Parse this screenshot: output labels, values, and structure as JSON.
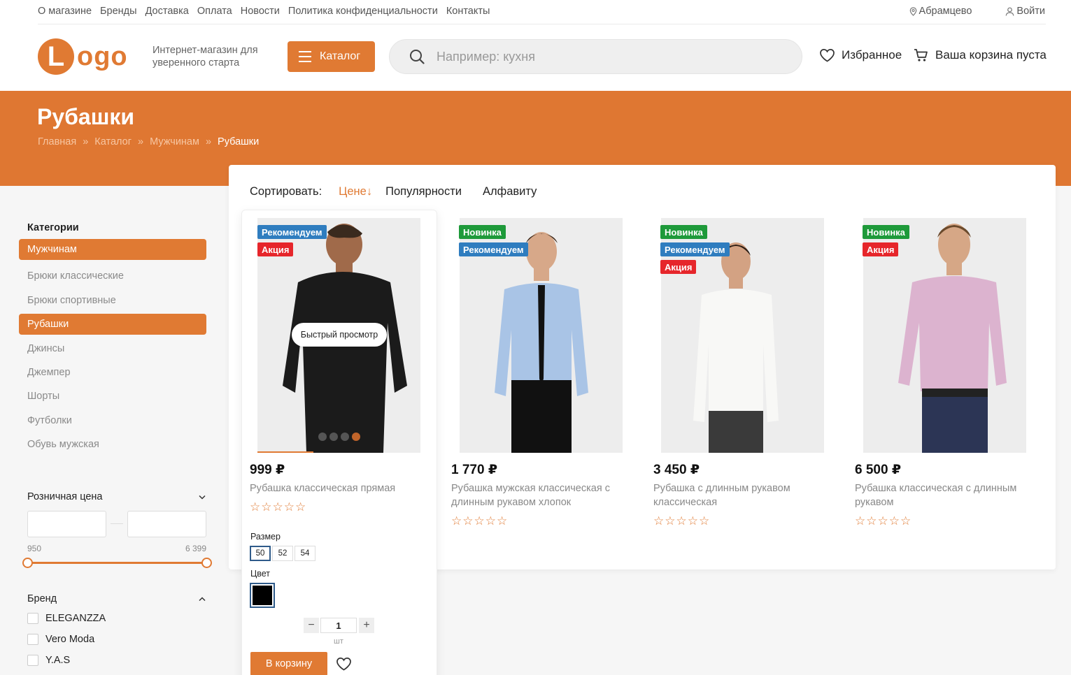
{
  "topnav": [
    "О магазине",
    "Бренды",
    "Доставка",
    "Оплата",
    "Новости",
    "Политика конфиденциальности",
    "Контакты"
  ],
  "location": "Абрамцево",
  "login": "Войти",
  "logo": {
    "letter": "L",
    "rest": "ogo"
  },
  "slogan": "Интернет-магазин для уверенного старта",
  "catalog_label": "Каталог",
  "search_placeholder": "Например: кухня",
  "favorites_label": "Избранное",
  "cart_label": "Ваша корзина пуста",
  "page_title": "Рубашки",
  "breadcrumbs": [
    "Главная",
    "Каталог",
    "Мужчинам",
    "Рубашки"
  ],
  "crumb_sep": "»",
  "sidebar": {
    "title": "Категории",
    "categories": [
      {
        "label": "Мужчинам",
        "active": true
      },
      {
        "label": "Брюки классические",
        "active": false
      },
      {
        "label": "Брюки спортивные",
        "active": false
      },
      {
        "label": "Рубашки",
        "active": true
      },
      {
        "label": "Джинсы",
        "active": false
      },
      {
        "label": "Джемпер",
        "active": false
      },
      {
        "label": "Шорты",
        "active": false
      },
      {
        "label": "Футболки",
        "active": false
      },
      {
        "label": "Обувь мужская",
        "active": false
      }
    ],
    "price_filter": {
      "title": "Розничная цена",
      "min_label": "950",
      "max_label": "6 399"
    },
    "brand_filter": {
      "title": "Бренд",
      "brands": [
        "ELEGANZZA",
        "Vero Moda",
        "Y.A.S"
      ]
    }
  },
  "sort": {
    "label": "Сортировать:",
    "options": [
      "Цене",
      "Популярности",
      "Алфавиту"
    ],
    "active": "Цене",
    "arrow": "↓"
  },
  "products": [
    {
      "price": "999 ₽",
      "name": "Рубашка классическая прямая",
      "badges": [
        "Рекомендуем",
        "Акция"
      ],
      "shirt_color": "#1b1b1b"
    },
    {
      "price": "1 770 ₽",
      "name": "Рубашка мужская классическая с длинным рукавом хлопок",
      "badges": [
        "Новинка",
        "Рекомендуем"
      ],
      "shirt_color": "#a9c4e6"
    },
    {
      "price": "3 450 ₽",
      "name": "Рубашка с длинным рукавом классическая",
      "badges": [
        "Новинка",
        "Рекомендуем",
        "Акция"
      ],
      "shirt_color": "#f8f8f6"
    },
    {
      "price": "6 500 ₽",
      "name": "Рубашка классическая с длинным рукавом",
      "badges": [
        "Новинка",
        "Акция"
      ],
      "shirt_color": "#dcb3cf"
    }
  ],
  "stars": "☆☆☆☆☆",
  "quick_view": "Быстрый просмотр",
  "size_label": "Размер",
  "sizes": [
    "50",
    "52",
    "54"
  ],
  "selected_size": "50",
  "color_label": "Цвет",
  "quantity": "1",
  "unit": "шт",
  "add_to_cart": "В корзину",
  "colors": {
    "accent": "#e07a33",
    "badge_recommend": "#2f7dbf",
    "badge_new": "#1e9a3a",
    "badge_sale": "#e6262b"
  }
}
